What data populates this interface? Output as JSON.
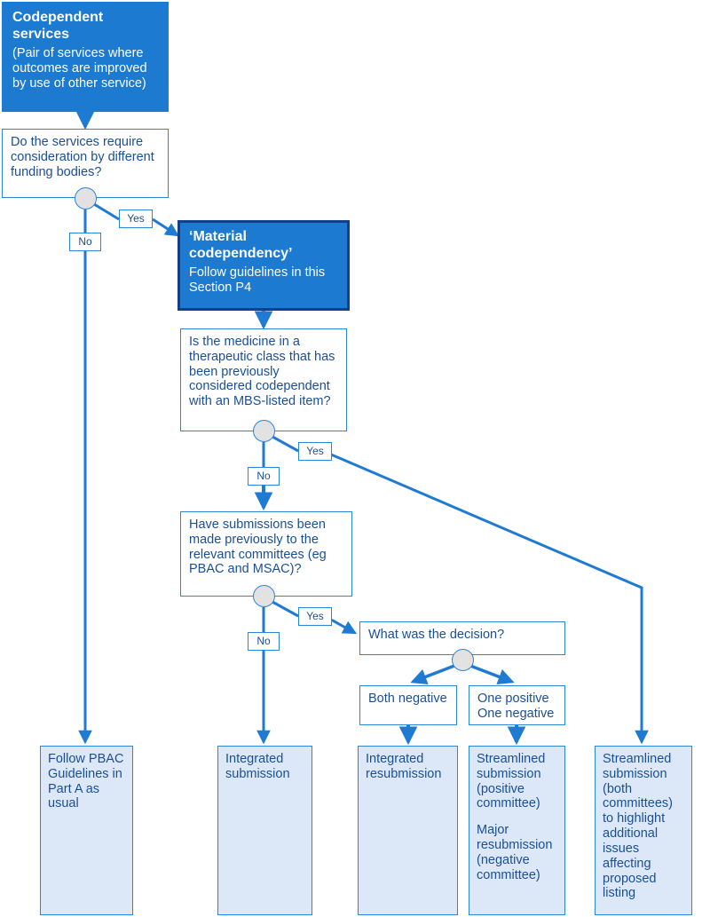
{
  "nodes": {
    "codependent_services": {
      "title": "Codependent services",
      "body": "(Pair of services where outcomes are improved by use of other service)"
    },
    "q_different_funding": {
      "text": "Do the services require consideration by different funding bodies?"
    },
    "material_codependency": {
      "title": "‘Material codependency’",
      "body": "Follow guidelines in this Section P4"
    },
    "q_therapeutic_class": {
      "text": "Is the medicine in a therapeutic class that has been previously considered codependent with an MBS-listed item?"
    },
    "q_previous_submissions": {
      "text": "Have submissions been made previously to the relevant committees (eg PBAC and MSAC)?"
    },
    "q_decision": {
      "text": "What was the decision?"
    },
    "both_negative": {
      "text": "Both negative"
    },
    "one_positive_one_negative": {
      "text": "One positive One negative"
    },
    "outcome_follow_pbac": {
      "text": "Follow PBAC Guidelines in Part A as usual"
    },
    "outcome_integrated_submission": {
      "text": "Integrated submission"
    },
    "outcome_integrated_resubmission": {
      "text": "Integrated resubmission"
    },
    "outcome_streamlined_positive": {
      "para1": "Streamlined submission (positive committee)",
      "para2": "Major resubmission (negative committee)"
    },
    "outcome_streamlined_both": {
      "text": "Streamlined submission (both committees) to highlight additional issues affecting proposed listing"
    }
  },
  "edge_labels": {
    "funding_yes": "Yes",
    "funding_no": "No",
    "therapeutic_yes": "Yes",
    "therapeutic_no": "No",
    "submissions_yes": "Yes",
    "submissions_no": "No"
  },
  "colors": {
    "header_fill": "#1c7ad0",
    "header_dark_border": "#10408a",
    "line": "#1f7ad4",
    "box_border": "#2b85d8",
    "outcome_fill": "#dce8f7",
    "text_blue": "#1a4f96",
    "junction_fill": "#e2e2e2",
    "white": "#ffffff"
  }
}
